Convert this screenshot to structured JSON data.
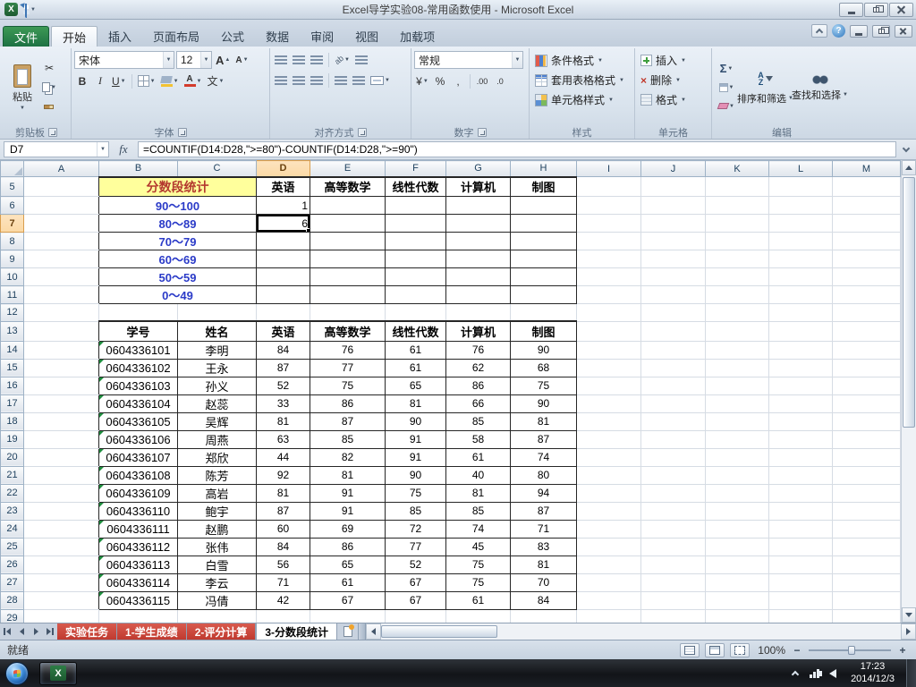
{
  "colors": {
    "stats_title_bg": "#FFFF9C",
    "stats_title_text": "#B4392F",
    "range_text": "#2B3BC8",
    "table_border": "#262626",
    "sheet_tab_red": "#C03A2F",
    "selection_header_bg": "#FBD9A5"
  },
  "icons": {
    "dd": "▼",
    "up": "▲",
    "scissors": "✂",
    "letter_A": "A",
    "x": "X",
    "multiply": "×",
    "currency": "¥",
    "percent": "%",
    "comma": ",",
    "dec_more": ".00",
    "dec_less": ".0",
    "orient": "ab",
    "phonetic": "文",
    "help": "?",
    "plus": "+",
    "minus": "−",
    "sort_a": "A",
    "sort_z": "Z"
  },
  "titlebar": {
    "title": "Excel导学实验08-常用函数使用  -  Microsoft Excel"
  },
  "ribbon": {
    "file_tab": "文件",
    "tabs": [
      {
        "label": "开始",
        "active": true
      },
      {
        "label": "插入",
        "active": false
      },
      {
        "label": "页面布局",
        "active": false
      },
      {
        "label": "公式",
        "active": false
      },
      {
        "label": "数据",
        "active": false
      },
      {
        "label": "审阅",
        "active": false
      },
      {
        "label": "视图",
        "active": false
      },
      {
        "label": "加载项",
        "active": false
      }
    ],
    "clipboard": {
      "paste": "粘贴",
      "label": "剪贴板"
    },
    "font": {
      "name": "宋体",
      "size": "12",
      "bold": "B",
      "italic": "I",
      "underline": "U",
      "label": "字体"
    },
    "alignment": {
      "label": "对齐方式"
    },
    "number": {
      "format": "常规",
      "label": "数字"
    },
    "styles": {
      "conditional": "条件格式",
      "format_as_table": "套用表格格式",
      "cell_styles": "单元格样式",
      "label": "样式"
    },
    "cells": {
      "insert": "插入",
      "delete": "删除",
      "format": "格式",
      "label": "单元格"
    },
    "editing": {
      "autosum": "Σ",
      "sort_filter": "排序和筛选",
      "find_select": "查找和选择",
      "label": "编辑"
    }
  },
  "formula_bar": {
    "name_box": "D7",
    "fx": "fx",
    "formula": "=COUNTIF(D14:D28,\">=80\")-COUNTIF(D14:D28,\">=90\")"
  },
  "sheet": {
    "columns": [
      "A",
      "B",
      "C",
      "D",
      "E",
      "F",
      "G",
      "H",
      "I",
      "J",
      "K",
      "L",
      "M"
    ],
    "first_row": 5,
    "last_row": 29,
    "selected": {
      "column": "D",
      "row": 7
    },
    "stats_table": {
      "title": "分数段统计",
      "subject_headers": [
        "英语",
        "高等数学",
        "线性代数",
        "计算机",
        "制图"
      ],
      "rows": [
        {
          "range": "90～100",
          "english": "1"
        },
        {
          "range": "80～89",
          "english": "6"
        },
        {
          "range": "70～79",
          "english": ""
        },
        {
          "range": "60～69",
          "english": ""
        },
        {
          "range": "50～59",
          "english": ""
        },
        {
          "range": "0～49",
          "english": ""
        }
      ]
    },
    "score_table": {
      "headers": [
        "学号",
        "姓名",
        "英语",
        "高等数学",
        "线性代数",
        "计算机",
        "制图"
      ],
      "students": [
        {
          "id": "0604336101",
          "name": "李明",
          "scores": [
            84,
            76,
            61,
            76,
            90
          ]
        },
        {
          "id": "0604336102",
          "name": "王永",
          "scores": [
            87,
            77,
            61,
            62,
            68
          ]
        },
        {
          "id": "0604336103",
          "name": "孙义",
          "scores": [
            52,
            75,
            65,
            86,
            75
          ]
        },
        {
          "id": "0604336104",
          "name": "赵蕊",
          "scores": [
            33,
            86,
            81,
            66,
            90
          ]
        },
        {
          "id": "0604336105",
          "name": "吴辉",
          "scores": [
            81,
            87,
            90,
            85,
            81
          ]
        },
        {
          "id": "0604336106",
          "name": "周燕",
          "scores": [
            63,
            85,
            91,
            58,
            87
          ]
        },
        {
          "id": "0604336107",
          "name": "郑欣",
          "scores": [
            44,
            82,
            91,
            61,
            74
          ]
        },
        {
          "id": "0604336108",
          "name": "陈芳",
          "scores": [
            92,
            81,
            90,
            40,
            80
          ]
        },
        {
          "id": "0604336109",
          "name": "高岩",
          "scores": [
            81,
            91,
            75,
            81,
            94
          ]
        },
        {
          "id": "0604336110",
          "name": "鲍宇",
          "scores": [
            87,
            91,
            85,
            85,
            87
          ]
        },
        {
          "id": "0604336111",
          "name": "赵鹏",
          "scores": [
            60,
            69,
            72,
            74,
            71
          ]
        },
        {
          "id": "0604336112",
          "name": "张伟",
          "scores": [
            84,
            86,
            77,
            45,
            83
          ]
        },
        {
          "id": "0604336113",
          "name": "白雪",
          "scores": [
            56,
            65,
            52,
            75,
            81
          ]
        },
        {
          "id": "0604336114",
          "name": "李云",
          "scores": [
            71,
            61,
            67,
            75,
            70
          ]
        },
        {
          "id": "0604336115",
          "name": "冯倩",
          "scores": [
            42,
            67,
            67,
            61,
            84
          ]
        }
      ]
    }
  },
  "sheet_tabs": [
    {
      "label": "实验任务",
      "active": false
    },
    {
      "label": "1-学生成绩",
      "active": false
    },
    {
      "label": "2-评分计算",
      "active": false
    },
    {
      "label": "3-分数段统计",
      "active": true
    }
  ],
  "status_bar": {
    "ready": "就绪",
    "zoom": "100%"
  },
  "taskbar": {
    "time": "17:23",
    "date": "2014/12/3"
  }
}
